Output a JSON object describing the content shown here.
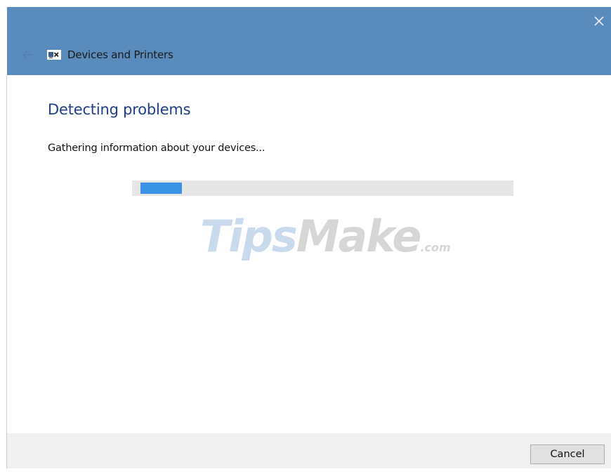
{
  "window": {
    "title": "Devices and Printers",
    "app_icon": "devices-printers-icon",
    "close_icon": "close-icon",
    "back_icon": "back-arrow-icon"
  },
  "main": {
    "heading": "Detecting problems",
    "status": "Gathering information about your devices...",
    "progress": {
      "fill_fraction": 0.06
    }
  },
  "watermark": {
    "part1": "Tips",
    "part2": "Make",
    "part3": ".com"
  },
  "footer": {
    "cancel_label": "Cancel"
  },
  "colors": {
    "titlebar": "#5a8bbd",
    "heading": "#1e3f8a",
    "progress_fill": "#3a92e4",
    "progress_track": "#e6e6e6",
    "footer": "#f0f0f0"
  }
}
